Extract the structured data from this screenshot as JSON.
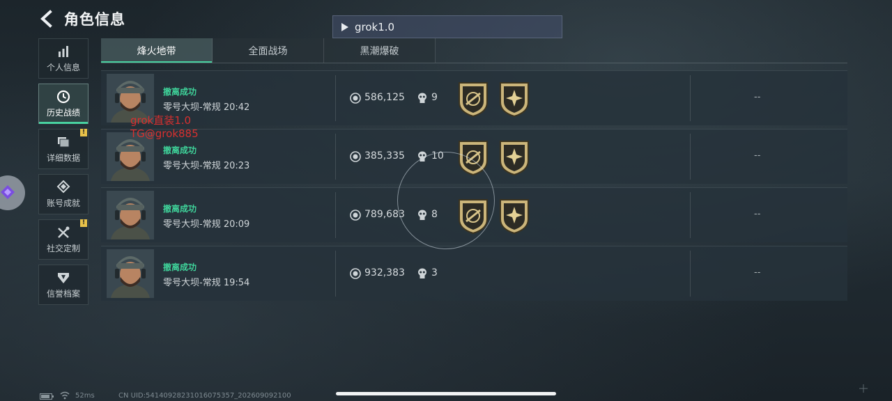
{
  "header": {
    "title": "角色信息"
  },
  "player": {
    "name": "grok1.0"
  },
  "sidebar": {
    "items": [
      {
        "label": "个人信息",
        "icon": "bar-chart-icon",
        "active": false,
        "alert": false
      },
      {
        "label": "历史战绩",
        "icon": "clock-icon",
        "active": true,
        "alert": false
      },
      {
        "label": "详细数据",
        "icon": "folder-icon",
        "active": false,
        "alert": true
      },
      {
        "label": "账号成就",
        "icon": "medal-icon",
        "active": false,
        "alert": false
      },
      {
        "label": "社交定制",
        "icon": "tools-icon",
        "active": false,
        "alert": true
      },
      {
        "label": "信誉档案",
        "icon": "shield-icon",
        "active": false,
        "alert": false
      }
    ],
    "alert_symbol": "!"
  },
  "tabs": [
    {
      "label": "烽火地带",
      "active": true
    },
    {
      "label": "全面战场",
      "active": false
    },
    {
      "label": "黑潮爆破",
      "active": false
    }
  ],
  "records": [
    {
      "status": "撤离成功",
      "map_time": "零号大坝-常规 20:42",
      "value": "586,125",
      "kills": "9",
      "badges": 2,
      "extra": "--"
    },
    {
      "status": "撤离成功",
      "map_time": "零号大坝-常规 20:23",
      "value": "385,335",
      "kills": "10",
      "badges": 2,
      "extra": "--"
    },
    {
      "status": "撤离成功",
      "map_time": "零号大坝-常规 20:09",
      "value": "789,683",
      "kills": "8",
      "badges": 2,
      "extra": "--"
    },
    {
      "status": "撤离成功",
      "map_time": "零号大坝-常规 19:54",
      "value": "932,383",
      "kills": "3",
      "badges": 0,
      "extra": "--"
    }
  ],
  "watermark": {
    "line1": "grok直装1.0",
    "line2": "TG@grok885"
  },
  "footer": {
    "ping": "52ms",
    "uid": "CN UID:54140928231016075357_202609092100"
  },
  "colors": {
    "accent": "#48d1a0",
    "success": "#3fd39a",
    "watermark": "#d8302f",
    "alert": "#e8c24a"
  }
}
